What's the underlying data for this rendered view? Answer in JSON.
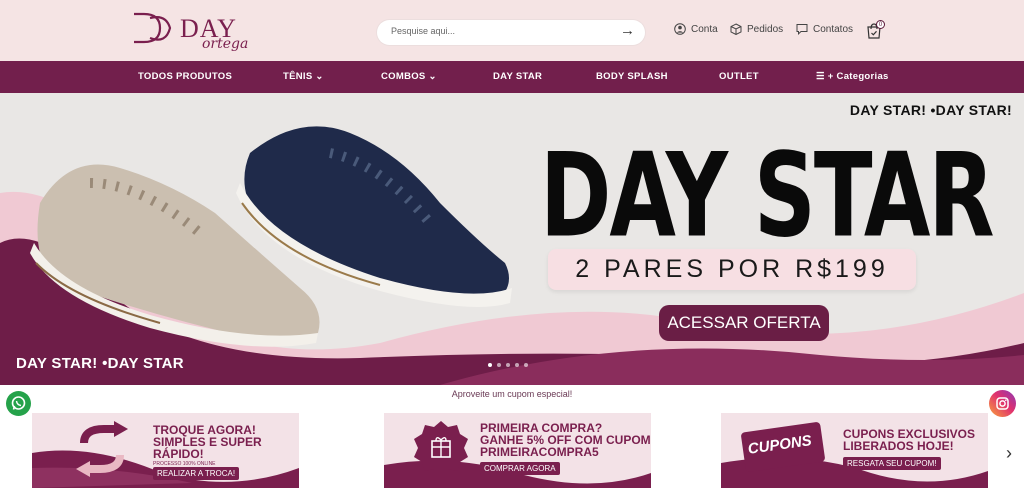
{
  "header": {
    "logo_text": "DAY",
    "logo_sub": "ortega",
    "search_placeholder": "Pesquise aqui...",
    "links": [
      {
        "label": "Conta",
        "icon": "user-icon"
      },
      {
        "label": "Pedidos",
        "icon": "box-icon"
      },
      {
        "label": "Contatos",
        "icon": "chat-icon"
      }
    ],
    "cart_count": "0"
  },
  "nav": {
    "items": [
      {
        "label": "TODOS PRODUTOS"
      },
      {
        "label": "TÊNIS  ⌄"
      },
      {
        "label": "COMBOS  ⌄"
      },
      {
        "label": "DAY STAR"
      },
      {
        "label": "BODY SPLASH"
      },
      {
        "label": "OUTLET"
      },
      {
        "label": "☰ + Categorias"
      }
    ]
  },
  "hero": {
    "top_text": "DAY STAR! •DAY STAR!",
    "title": "DAY STAR",
    "offer": "2 PARES POR R$199",
    "cta": "ACESSAR OFERTA",
    "bottom_text": "DAY STAR! •DAY STAR",
    "slides": 5,
    "active_slide": 1
  },
  "coupons": {
    "title": "Aproveite um cupom especial!",
    "cards": [
      {
        "line1": "TROQUE AGORA!",
        "line2": "SIMPLES E SUPER",
        "line3": "RÁPIDO!",
        "note": "PROCESSO 100% ONLINE",
        "button": "REALIZAR A TROCA!"
      },
      {
        "line1": "PRIMEIRA COMPRA?",
        "line2": "GANHE 5% OFF COM CUPOM",
        "line3": "PRIMEIRACOMPRA5",
        "button": "COMPRAR AGORA"
      },
      {
        "line1": "CUPONS EXCLUSIVOS",
        "line2": "LIBERADOS HOJE!",
        "button": "RESGATA SEU CUPOM!",
        "badge_text": "CUPONS"
      }
    ]
  },
  "colors": {
    "header_bg": "#f5e4e4",
    "nav_bg": "#721f4c",
    "brand": "#7a1f4e",
    "cta_bg": "#6a1e45"
  }
}
